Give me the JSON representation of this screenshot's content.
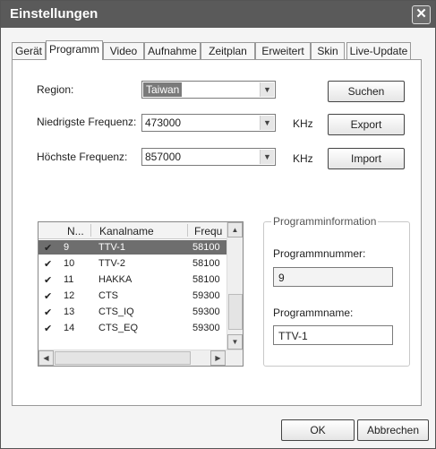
{
  "window": {
    "title": "Einstellungen"
  },
  "tabs": [
    "Gerät",
    "Programm",
    "Video",
    "Aufnahme",
    "Zeitplan",
    "Erweitert",
    "Skin",
    "Live-Update"
  ],
  "active_tab": "Programm",
  "region": {
    "label": "Region:",
    "value": "Taiwan"
  },
  "min_freq": {
    "label": "Niedrigste Frequenz:",
    "value": "473000",
    "unit": "KHz"
  },
  "max_freq": {
    "label": "Höchste Frequenz:",
    "value": "857000",
    "unit": "KHz"
  },
  "buttons": {
    "search": "Suchen",
    "export": "Export",
    "import": "Import",
    "ok": "OK",
    "cancel": "Abbrechen"
  },
  "channel_list": {
    "columns": [
      "N...",
      "Kanalname",
      "Frequ"
    ],
    "rows": [
      {
        "num": "9",
        "name": "TTV-1",
        "freq": "58100",
        "checked": true,
        "selected": true
      },
      {
        "num": "10",
        "name": "TTV-2",
        "freq": "58100",
        "checked": true,
        "selected": false
      },
      {
        "num": "11",
        "name": "HAKKA",
        "freq": "58100",
        "checked": true,
        "selected": false
      },
      {
        "num": "12",
        "name": "CTS",
        "freq": "59300",
        "checked": true,
        "selected": false
      },
      {
        "num": "13",
        "name": "CTS_IQ",
        "freq": "59300",
        "checked": true,
        "selected": false
      },
      {
        "num": "14",
        "name": "CTS_EQ",
        "freq": "59300",
        "checked": true,
        "selected": false
      }
    ],
    "check_glyph": "✔"
  },
  "program_info": {
    "group_title": "Programminformation",
    "number_label": "Programmnummer:",
    "number_value": "9",
    "name_label": "Programmname:",
    "name_value": "TTV-1"
  },
  "icons": {
    "close": "close-icon",
    "dropdown": "chevron-down-icon",
    "scroll_up": "arrow-up-icon",
    "scroll_down": "arrow-down-icon",
    "scroll_left": "arrow-left-icon",
    "scroll_right": "arrow-right-icon"
  }
}
